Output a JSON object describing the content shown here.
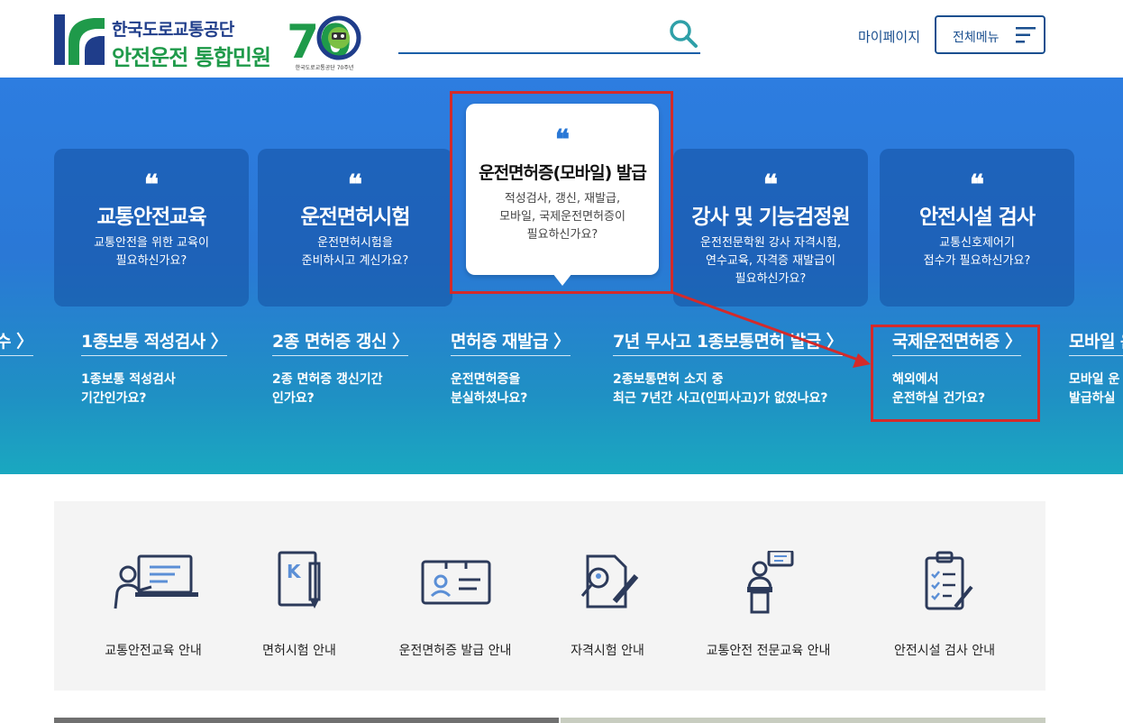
{
  "header": {
    "org_name": "한국도로교통공단",
    "service_name": "안전운전 통합민원",
    "anniversary_number": "70",
    "anniversary_caption": "한국도로교통공단 70주년",
    "search_placeholder": "",
    "mypage_label": "마이페이지",
    "allmenu_label": "전체메뉴"
  },
  "hero": {
    "quote_mark": "❝",
    "cards": [
      {
        "title": "교통안전교육",
        "desc": "교통안전을 위한 교육이\n필요하신가요?"
      },
      {
        "title": "운전면허시험",
        "desc": "운전면허시험을\n준비하시고 계신가요?"
      },
      {
        "title": "운전면허증(모바일) 발급",
        "desc": "적성검사, 갱신, 재발급,\n모바일, 국제운전면허증이\n필요하신가요?"
      },
      {
        "title": "강사 및 기능검정원",
        "desc": "운전전문학원 강사 자격시험,\n연수교육, 자격증 재발급이\n필요하신가요?"
      },
      {
        "title": "안전시설 검사",
        "desc": "교통신호제어기\n접수가 필요하신가요?"
      }
    ],
    "links": [
      {
        "title": "접수 〉",
        "desc": "\n?"
      },
      {
        "title": "1종보통 적성검사 〉",
        "desc": "1종보통 적성검사\n기간인가요?"
      },
      {
        "title": "2종 면허증 갱신 〉",
        "desc": "2종 면허증 갱신기간\n인가요?"
      },
      {
        "title": "면허증 재발급 〉",
        "desc": "운전면허증을\n분실하셨나요?"
      },
      {
        "title": "7년 무사고 1종보통면허 발급 〉",
        "desc": "2종보통면허 소지 중\n최근 7년간 사고(인피사고)가 없었나요?"
      },
      {
        "title": "국제운전면허증 〉",
        "desc": "해외에서\n운전하실 건가요?"
      },
      {
        "title": "모바일 운",
        "desc": "모바일 운\n발급하실"
      }
    ]
  },
  "quick_menu": [
    {
      "label": "교통안전교육 안내",
      "icon": "presentation-board-icon"
    },
    {
      "label": "면허시험 안내",
      "icon": "license-notebook-pen-icon"
    },
    {
      "label": "운전면허증 발급 안내",
      "icon": "id-card-icon"
    },
    {
      "label": "자격시험 안내",
      "icon": "document-magnifier-pen-icon"
    },
    {
      "label": "교통안전 전문교육 안내",
      "icon": "lecturer-podium-icon"
    },
    {
      "label": "안전시설 검사 안내",
      "icon": "clipboard-checklist-icon"
    }
  ],
  "colors": {
    "brand_blue": "#1f3d8a",
    "brand_green": "#1f9a4a",
    "highlight_red": "#d42a2a",
    "icon_navy": "#2c3a5a",
    "icon_accent": "#5b8fd6"
  }
}
